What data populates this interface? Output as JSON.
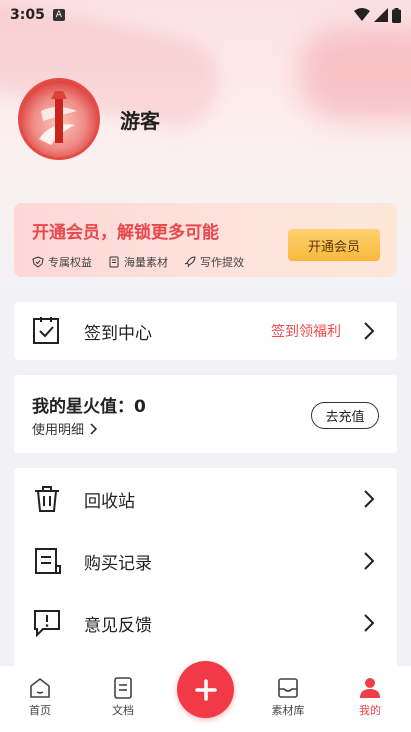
{
  "status_bar": {
    "time": "3:05",
    "app_icon": "A"
  },
  "profile": {
    "username": "游客"
  },
  "vip": {
    "title": "开通会员，解锁更多可能",
    "perks": [
      {
        "icon": "shield-icon",
        "label": "专属权益"
      },
      {
        "icon": "document-icon",
        "label": "海量素材"
      },
      {
        "icon": "rocket-icon",
        "label": "写作提效"
      }
    ],
    "button_label": "开通会员"
  },
  "checkin": {
    "label": "签到中心",
    "link": "签到领福利"
  },
  "points": {
    "title": "我的星火值：0",
    "detail_label": "使用明细",
    "recharge_label": "去充值"
  },
  "menu": {
    "items": [
      {
        "icon": "trash-icon",
        "label": "回收站"
      },
      {
        "icon": "receipt-icon",
        "label": "购买记录"
      },
      {
        "icon": "feedback-icon",
        "label": "意见反馈"
      }
    ]
  },
  "tabbar": {
    "tabs": [
      {
        "label": "首页",
        "icon": "home-icon",
        "active": false
      },
      {
        "label": "文档",
        "icon": "document-icon",
        "active": false
      },
      {
        "label": "素材库",
        "icon": "inbox-icon",
        "active": false
      },
      {
        "label": "我的",
        "icon": "user-icon",
        "active": true
      }
    ],
    "fab_icon": "plus-icon"
  },
  "colors": {
    "accent": "#f03e48",
    "vip_gold": "#f8b83c",
    "vip_text": "#e8484c"
  }
}
